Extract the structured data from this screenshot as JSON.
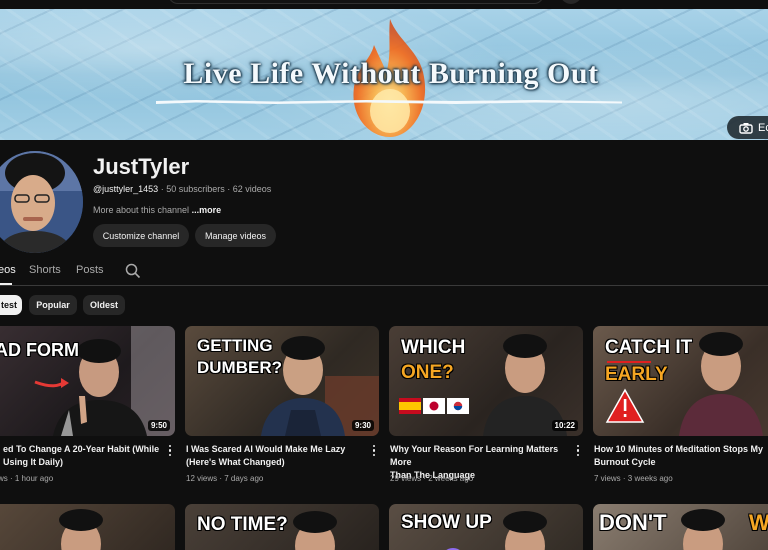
{
  "banner": {
    "title": "Live Life Without Burning Out",
    "edit_label": "Ec"
  },
  "channel": {
    "name": "JustTyler",
    "handle": "@justtyler_1453",
    "subscribers": "50 subscribers",
    "videos": "62 videos",
    "separator": "·",
    "about": "More about this channel",
    "more_link": "...more",
    "customize_label": "Customize channel",
    "manage_label": "Manage videos"
  },
  "tabs": [
    {
      "label": "eos",
      "active": true
    },
    {
      "label": "Shorts",
      "active": false
    },
    {
      "label": "Posts",
      "active": false
    }
  ],
  "chips": [
    {
      "label": "test",
      "active": true
    },
    {
      "label": "Popular",
      "active": false
    },
    {
      "label": "Oldest",
      "active": false
    }
  ],
  "videos": [
    {
      "thumb_text": [
        "AD FORM"
      ],
      "duration": "9:50",
      "title_line1": "ed To Change A 20-Year Habit (While",
      "title_line2": "Using It Daily)",
      "stats": "ws · 1 hour ago"
    },
    {
      "thumb_text": [
        "GETTING",
        "DUMBER?"
      ],
      "duration": "9:30",
      "title_line1": "I Was Scared AI Would Make Me Lazy",
      "title_line2": "(Here's What Changed)",
      "stats": "12 views · 7 days ago"
    },
    {
      "thumb_text": [
        "WHICH",
        "ONE?"
      ],
      "duration": "10:22",
      "title_line1": "Why Your Reason For Learning Matters More",
      "title_line2": "Than The Language",
      "stats": "29 views · 2 weeks ago"
    },
    {
      "thumb_text": [
        "CATCH IT",
        "EARLY"
      ],
      "duration": "",
      "title_line1": "How 10 Minutes of Meditation Stops My",
      "title_line2": "Burnout Cycle",
      "stats": "7 views · 3 weeks ago"
    }
  ],
  "row2": [
    {
      "thumb_text": ""
    },
    {
      "thumb_text": "NO TIME?"
    },
    {
      "thumb_text": "SHOW UP"
    },
    {
      "thumb_text": "DON'T",
      "thumb_text_b": "WA"
    }
  ],
  "icons": {
    "camera": "camera-icon",
    "search": "search-icon",
    "more": "more-vert-icon",
    "flame": "flame-icon",
    "warning": "warning-icon"
  },
  "colors": {
    "background": "#0f0f0f",
    "chip_active": "#f1f1f1",
    "text_secondary": "#aaaaaa",
    "accent_orange": "#f5a623",
    "accent_red": "#e02020"
  }
}
